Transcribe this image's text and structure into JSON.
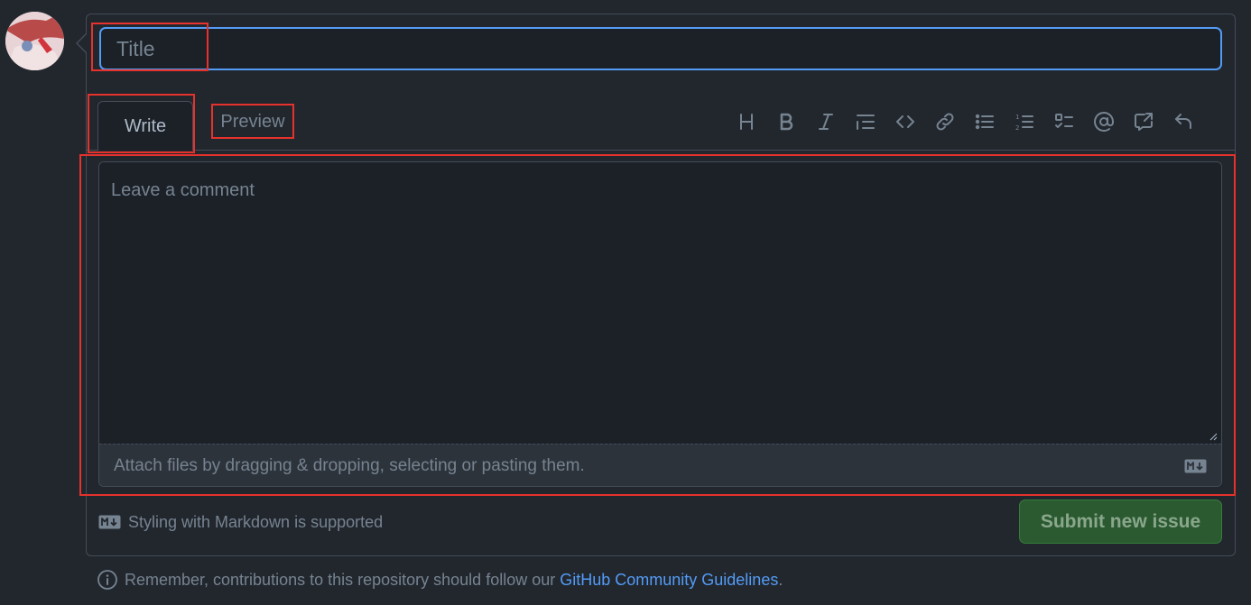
{
  "form": {
    "title_placeholder": "Title",
    "comment_placeholder": "Leave a comment"
  },
  "tabs": {
    "write": "Write",
    "preview": "Preview"
  },
  "toolbar": {
    "icons": [
      "heading-icon",
      "bold-icon",
      "italic-icon",
      "quote-icon",
      "code-icon",
      "link-icon",
      "unordered-list-icon",
      "ordered-list-icon",
      "task-list-icon",
      "mention-icon",
      "cross-reference-icon",
      "reply-icon"
    ]
  },
  "attach": {
    "text": "Attach files by dragging & dropping, selecting or pasting them."
  },
  "markdown": {
    "note": "Styling with Markdown is supported"
  },
  "actions": {
    "submit_label": "Submit new issue"
  },
  "footer": {
    "prefix": "Remember, contributions to this repository should follow our ",
    "link_text": "GitHub Community Guidelines",
    "suffix": "."
  },
  "colors": {
    "background": "#22272e",
    "input_background": "#1c2128",
    "border": "#444c56",
    "focus_border": "#539bf5",
    "submit_background": "#2b5a31",
    "link": "#539bf5",
    "annotation_red": "#e5322d"
  }
}
